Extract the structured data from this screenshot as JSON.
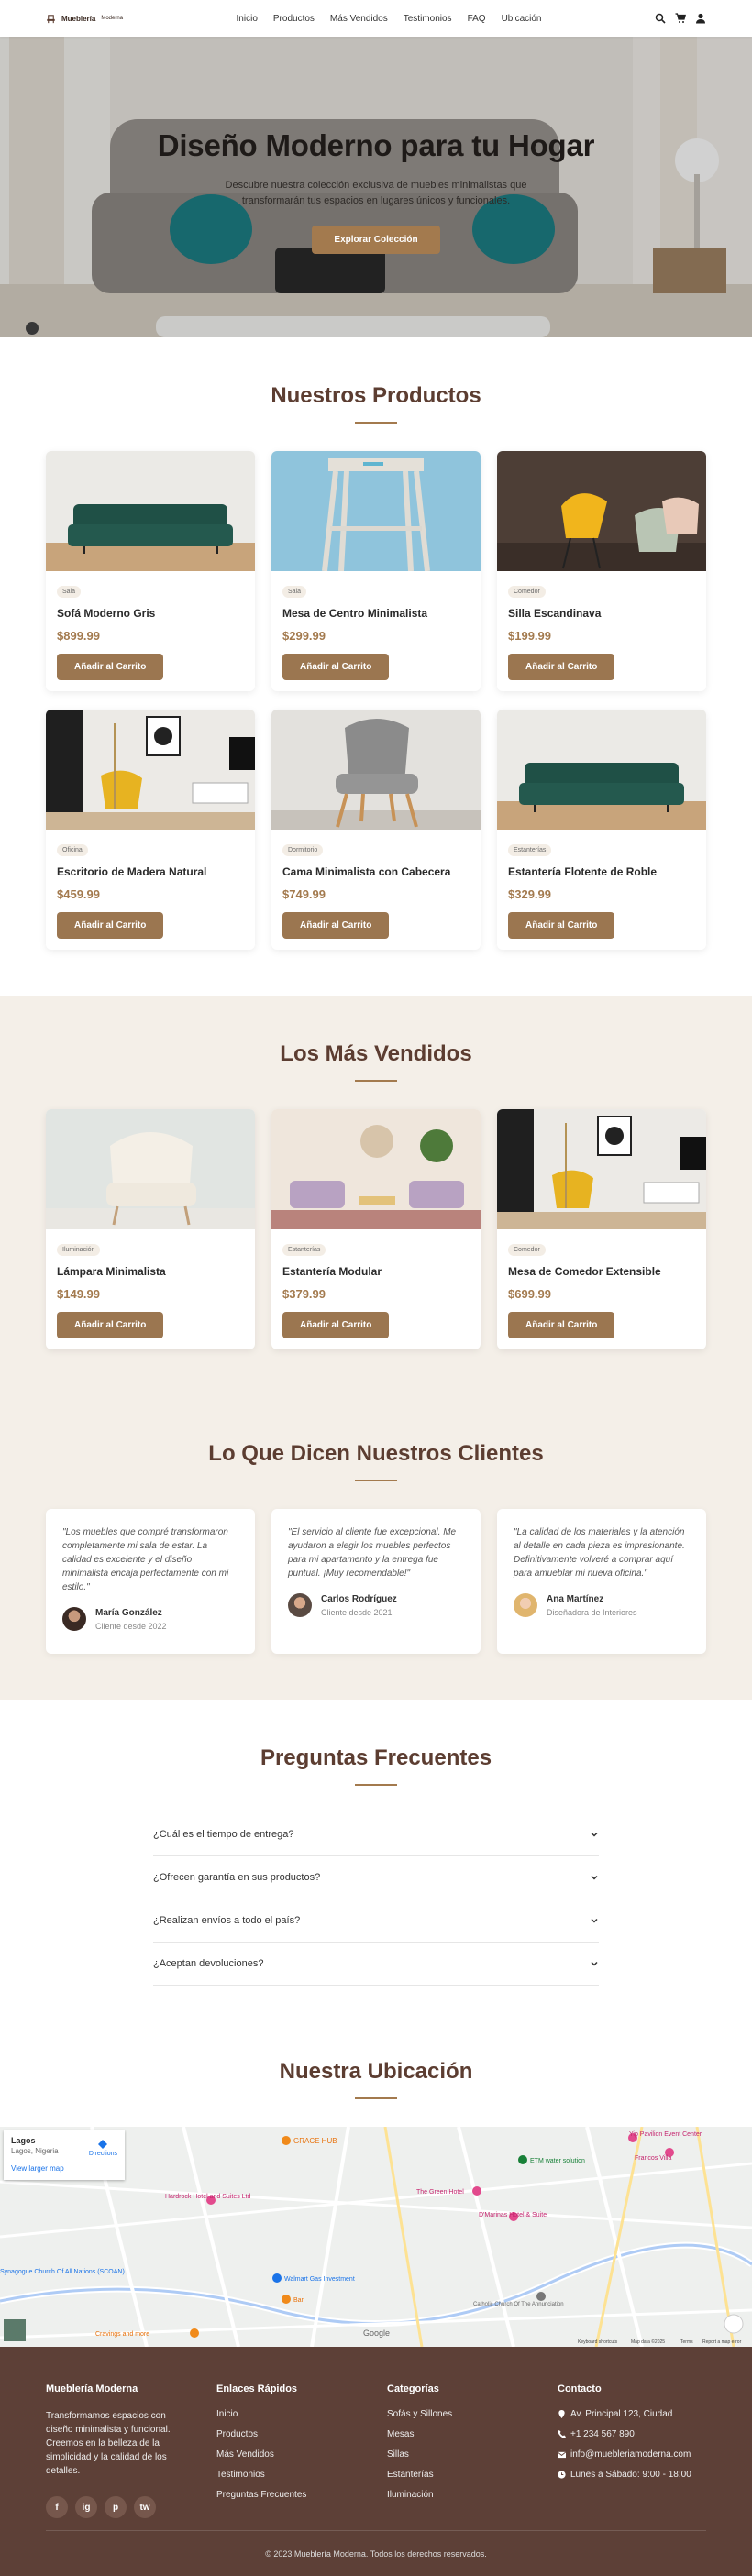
{
  "nav": {
    "brand": "Mueblería",
    "brand_suffix": "Moderna",
    "links": [
      "Inicio",
      "Productos",
      "Más Vendidos",
      "Testimonios",
      "FAQ",
      "Ubicación"
    ],
    "icons": [
      "search-icon",
      "cart-icon",
      "user-icon"
    ]
  },
  "hero": {
    "title": "Diseño Moderno para tu Hogar",
    "subtitle": "Descubre nuestra colección exclusiva de muebles minimalistas que transformarán tus espacios en lugares únicos y funcionales.",
    "cta": "Explorar Colección"
  },
  "products": {
    "title": "Nuestros Productos",
    "button_label": "Añadir al Carrito",
    "items": [
      {
        "category": "Sala",
        "name": "Sofá Moderno Gris",
        "price": "$899.99"
      },
      {
        "category": "Sala",
        "name": "Mesa de Centro Minimalista",
        "price": "$299.99"
      },
      {
        "category": "Comedor",
        "name": "Silla Escandinava",
        "price": "$199.99"
      },
      {
        "category": "Oficina",
        "name": "Escritorio de Madera Natural",
        "price": "$459.99"
      },
      {
        "category": "Dormitorio",
        "name": "Cama Minimalista con Cabecera",
        "price": "$749.99"
      },
      {
        "category": "Estanterías",
        "name": "Estantería Flotente de Roble",
        "price": "$329.99"
      }
    ]
  },
  "bestsellers": {
    "title": "Los Más Vendidos",
    "button_label": "Añadir al Carrito",
    "items": [
      {
        "category": "Iluminación",
        "name": "Lámpara Minimalista",
        "price": "$149.99"
      },
      {
        "category": "Estanterías",
        "name": "Estantería Modular",
        "price": "$379.99"
      },
      {
        "category": "Comedor",
        "name": "Mesa de Comedor Extensible",
        "price": "$699.99"
      }
    ]
  },
  "testimonials": {
    "title": "Lo Que Dicen Nuestros Clientes",
    "items": [
      {
        "quote": "\"Los muebles que compré transformaron completamente mi sala de estar. La calidad es excelente y el diseño minimalista encaja perfectamente con mi estilo.\"",
        "name": "María González",
        "role": "Cliente desde 2022"
      },
      {
        "quote": "\"El servicio al cliente fue excepcional. Me ayudaron a elegir los muebles perfectos para mi apartamento y la entrega fue puntual. ¡Muy recomendable!\"",
        "name": "Carlos Rodríguez",
        "role": "Cliente desde 2021"
      },
      {
        "quote": "\"La calidad de los materiales y la atención al detalle en cada pieza es impresionante. Definitivamente volveré a comprar aquí para amueblar mi nueva oficina.\"",
        "name": "Ana Martínez",
        "role": "Diseñadora de Interiores"
      }
    ]
  },
  "faq": {
    "title": "Preguntas Frecuentes",
    "items": [
      "¿Cuál es el tiempo de entrega?",
      "¿Ofrecen garantía en sus productos?",
      "¿Realizan envíos a todo el país?",
      "¿Aceptan devoluciones?"
    ]
  },
  "location": {
    "title": "Nuestra Ubicación",
    "map_place": "Lagos",
    "map_address": "Lagos, Nigeria",
    "map_link": "View larger map",
    "map_directions": "Directions",
    "map_labels": [
      "GRACE HUB",
      "ETM water solution",
      "The Green Hotel",
      "D'Marinas Hotel & Suite",
      "Hardrock Hotel and Suites Ltd",
      "Walmart Gas Investment",
      "Bar",
      "Cravings and more",
      "Catholic Church Of The Annunciation",
      "Yip Pavilion Event Center",
      "Francos Villa",
      "Synagogue Church Of All Nations (SCOAN)",
      "Google",
      "Keyboard shortcuts",
      "Map data ©2025",
      "Terms",
      "Report a map error"
    ]
  },
  "footer": {
    "about_title": "Mueblería Moderna",
    "about_text": "Transformamos espacios con diseño minimalista y funcional. Creemos en la belleza de la simplicidad y la calidad de los detalles.",
    "socials": [
      "f",
      "ig",
      "p",
      "tw"
    ],
    "links_title": "Enlaces Rápidos",
    "links": [
      "Inicio",
      "Productos",
      "Más Vendidos",
      "Testimonios",
      "Preguntas Frecuentes"
    ],
    "categories_title": "Categorías",
    "categories": [
      "Sofás y Sillones",
      "Mesas",
      "Sillas",
      "Estanterías",
      "Iluminación"
    ],
    "contact_title": "Contacto",
    "contact": [
      {
        "icon": "map-pin-icon",
        "text": "Av. Principal 123, Ciudad"
      },
      {
        "icon": "phone-icon",
        "text": "+1 234 567 890"
      },
      {
        "icon": "mail-icon",
        "text": "info@muebleriamoderna.com"
      },
      {
        "icon": "clock-icon",
        "text": "Lunes a Sábado: 9:00 - 18:00"
      }
    ],
    "copyright": "© 2023 Mueblería Moderna. Todos los derechos reservados."
  },
  "colors": {
    "accent": "#a37a4e",
    "heading": "#5c3d31",
    "footer": "#5d4037",
    "beige": "#f4efe8"
  }
}
